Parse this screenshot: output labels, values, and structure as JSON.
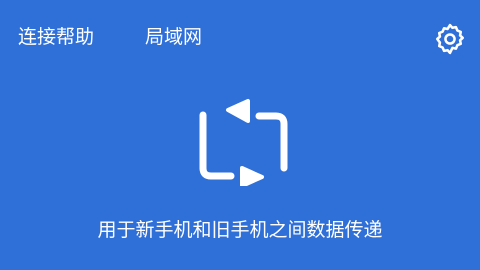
{
  "theme": {
    "background": "#2f6fd8",
    "foreground": "#ffffff"
  },
  "header": {
    "help_label": "连接帮助",
    "lan_label": "局域网",
    "settings_icon": "gear-icon"
  },
  "main": {
    "center_icon": "transfer-arrows-icon",
    "caption": "用于新手机和旧手机之间数据传递"
  }
}
